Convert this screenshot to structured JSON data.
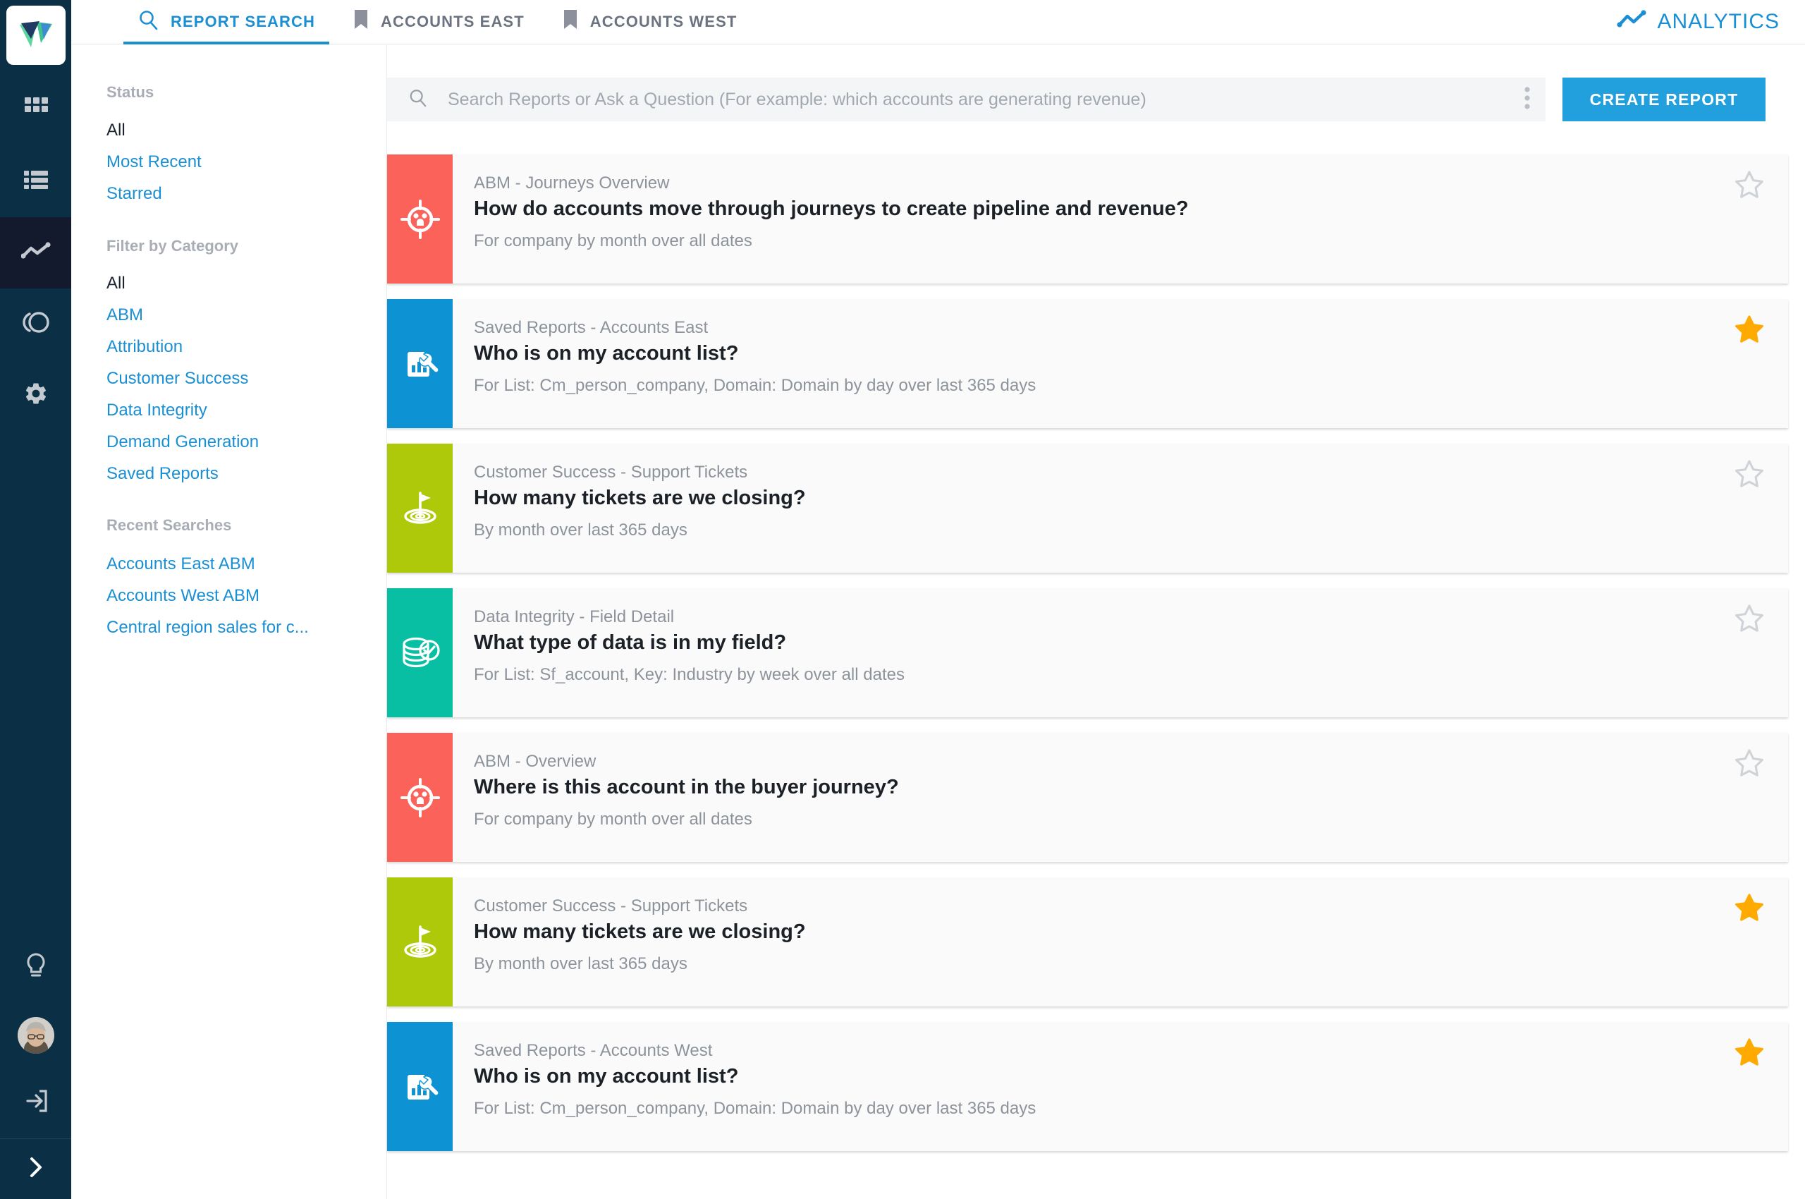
{
  "rail": {
    "logo_icon": "app-logo",
    "items": [
      {
        "icon": "grid-icon",
        "name": "dashboard",
        "active": false
      },
      {
        "icon": "list-icon",
        "name": "lists",
        "active": false
      },
      {
        "icon": "analytics-icon",
        "name": "analytics",
        "active": true
      },
      {
        "icon": "segments-icon",
        "name": "segments",
        "active": false
      },
      {
        "icon": "gear-icon",
        "name": "settings",
        "active": false
      }
    ],
    "bottom": [
      {
        "icon": "lightbulb-icon",
        "name": "ideas"
      },
      {
        "icon": "avatar",
        "name": "user-avatar"
      },
      {
        "icon": "logout-icon",
        "name": "logout"
      }
    ],
    "expand_icon": "chevron-right-icon"
  },
  "topbar": {
    "tabs": [
      {
        "label": "REPORT SEARCH",
        "icon": "search-icon",
        "active": true
      },
      {
        "label": "ACCOUNTS EAST",
        "icon": "bookmark-icon",
        "active": false
      },
      {
        "label": "ACCOUNTS WEST",
        "icon": "bookmark-icon",
        "active": false
      }
    ],
    "brand": {
      "label": "ANALYTICS",
      "icon": "trendline-icon",
      "color": "#1a8fd4"
    }
  },
  "filters": {
    "status": {
      "heading": "Status",
      "items": [
        {
          "label": "All",
          "selected": true
        },
        {
          "label": "Most Recent",
          "selected": false
        },
        {
          "label": "Starred",
          "selected": false
        }
      ]
    },
    "category": {
      "heading": "Filter by Category",
      "items": [
        {
          "label": "All",
          "selected": true
        },
        {
          "label": "ABM",
          "selected": false
        },
        {
          "label": "Attribution",
          "selected": false
        },
        {
          "label": "Customer Success",
          "selected": false
        },
        {
          "label": "Data Integrity",
          "selected": false
        },
        {
          "label": "Demand Generation",
          "selected": false
        },
        {
          "label": "Saved Reports",
          "selected": false
        }
      ]
    },
    "recent": {
      "heading": "Recent Searches",
      "items": [
        {
          "label": "Accounts East ABM"
        },
        {
          "label": "Accounts West ABM"
        },
        {
          "label": "Central region sales for c..."
        }
      ]
    }
  },
  "search": {
    "placeholder": "Search Reports or Ask a Question (For example: which accounts are generating revenue)",
    "value": "",
    "menu_icon": "more-vertical-icon",
    "icon": "search-icon"
  },
  "toolbar": {
    "create_label": "CREATE REPORT",
    "accent": "#21a0dd"
  },
  "reports": [
    {
      "category": "ABM - Journeys Overview",
      "title": "How do accounts move through journeys to create pipeline and revenue?",
      "meta": "For company by month over all dates",
      "color": "#fb6259",
      "icon": "target-people-icon",
      "starred": false
    },
    {
      "category": "Saved Reports - Accounts East",
      "title": "Who is on my account list?",
      "meta": "For List: Cm_person_company, Domain: Domain by day over last 365 days",
      "color": "#0d93d4",
      "icon": "report-wrench-icon",
      "starred": true
    },
    {
      "category": "Customer Success - Support Tickets",
      "title": "How many tickets are we closing?",
      "meta": "By month over last 365 days",
      "color": "#aec90a",
      "icon": "flag-target-icon",
      "starred": false
    },
    {
      "category": "Data Integrity - Field Detail",
      "title": "What type of data is in my field?",
      "meta": "For List: Sf_account, Key: Industry by week over all dates",
      "color": "#08bfa4",
      "icon": "database-check-icon",
      "starred": false
    },
    {
      "category": "ABM - Overview",
      "title": "Where is this account in the buyer journey?",
      "meta": "For company by month over all dates",
      "color": "#fb6259",
      "icon": "target-people-icon",
      "starred": false
    },
    {
      "category": "Customer Success - Support Tickets",
      "title": "How many tickets are we closing?",
      "meta": "By month over last 365 days",
      "color": "#aec90a",
      "icon": "flag-target-icon",
      "starred": true
    },
    {
      "category": "Saved Reports - Accounts West",
      "title": "Who is on my account list?",
      "meta": "For List: Cm_person_company, Domain: Domain by day over last 365 days",
      "color": "#0d93d4",
      "icon": "report-wrench-icon",
      "starred": true
    }
  ],
  "colors": {
    "star_on": "#ffaa00",
    "star_off": "#cfd3d7",
    "rail_bg": "#0b2f45",
    "link": "#1a8fd4"
  }
}
